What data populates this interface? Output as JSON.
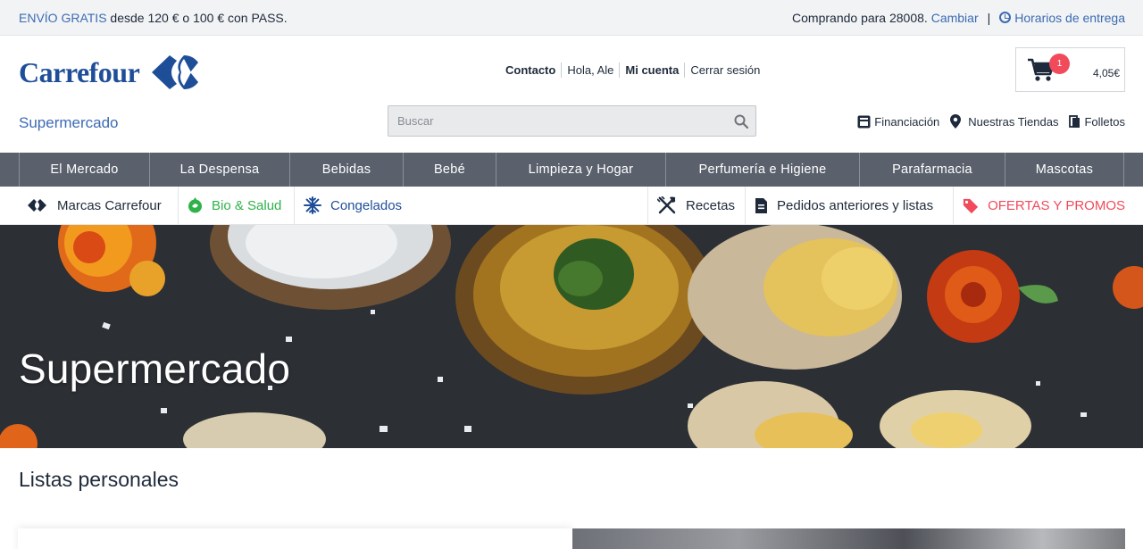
{
  "topbar": {
    "promo_highlight": "ENVÍO GRATIS",
    "promo_rest": " desde 120 € o 100 € con PASS.",
    "shopping_for": "Comprando para 28008.",
    "change_link": "Cambiar",
    "separator": "|",
    "delivery_times": "Horarios de entrega"
  },
  "header": {
    "logo_text": "Carrefour",
    "section_title": "Supermercado",
    "account_links": {
      "contact": "Contacto",
      "greeting": "Hola, Ale",
      "my_account": "Mi cuenta",
      "logout": "Cerrar sesión"
    },
    "search": {
      "placeholder": "Buscar"
    },
    "cart": {
      "count": "1",
      "total": "4,05€"
    },
    "utility": {
      "financing": "Financiación",
      "stores": "Nuestras Tiendas",
      "leaflets": "Folletos"
    }
  },
  "main_nav": {
    "items": [
      {
        "label": "El Mercado"
      },
      {
        "label": "La Despensa"
      },
      {
        "label": "Bebidas"
      },
      {
        "label": "Bebé"
      },
      {
        "label": "Limpieza y Hogar"
      },
      {
        "label": "Perfumería e Higiene"
      },
      {
        "label": "Parafarmacia"
      },
      {
        "label": "Mascotas"
      }
    ]
  },
  "sub_nav": {
    "brands": "Marcas Carrefour",
    "bio": "Bio & Salud",
    "frozen": "Congelados",
    "recipes": "Recetas",
    "orders": "Pedidos anteriores y listas",
    "offers": "OFERTAS Y PROMOS"
  },
  "hero": {
    "title": "Supermercado"
  },
  "lists": {
    "title": "Listas personales"
  },
  "colors": {
    "brand_blue": "#1f4e99",
    "link_blue": "#3c6bb3",
    "nav_gray": "#5a616d",
    "bio_green": "#2fb24a",
    "offers_red": "#f04a5b"
  }
}
